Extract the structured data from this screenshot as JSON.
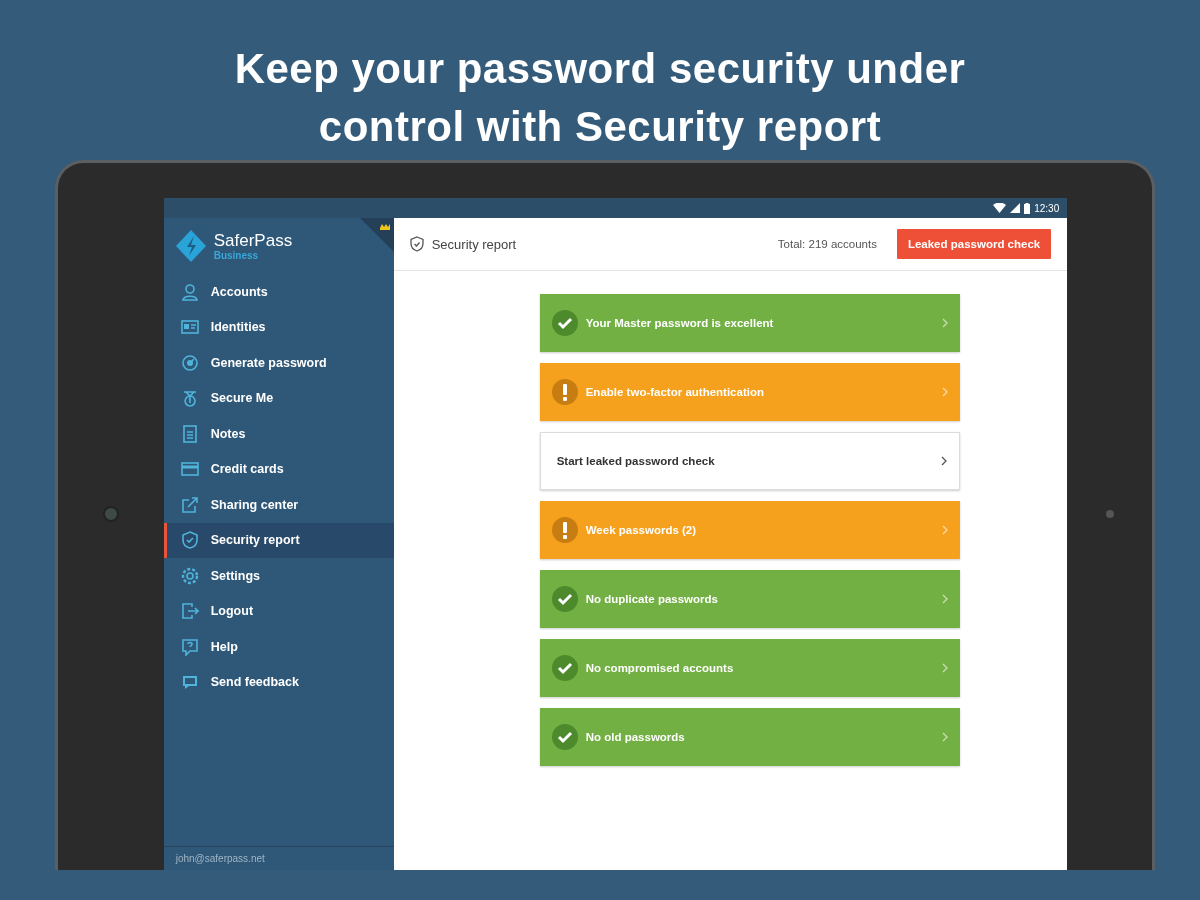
{
  "headline": "Keep your password security under control with Security report",
  "status_bar": {
    "time": "12:30"
  },
  "sidebar": {
    "brand": "SaferPass",
    "edition": "Business",
    "items": [
      {
        "label": "Accounts",
        "selected": false
      },
      {
        "label": "Identities",
        "selected": false
      },
      {
        "label": "Generate password",
        "selected": false
      },
      {
        "label": "Secure Me",
        "selected": false
      },
      {
        "label": "Notes",
        "selected": false
      },
      {
        "label": "Credit cards",
        "selected": false
      },
      {
        "label": "Sharing center",
        "selected": false
      },
      {
        "label": "Security report",
        "selected": true
      },
      {
        "label": "Settings",
        "selected": false
      },
      {
        "label": "Logout",
        "selected": false
      },
      {
        "label": "Help",
        "selected": false
      },
      {
        "label": "Send feedback",
        "selected": false
      }
    ],
    "account": "john@saferpass.net"
  },
  "header": {
    "title": "Security report",
    "total": "Total: 219 accounts",
    "button": "Leaked password check"
  },
  "checks": [
    {
      "kind": "pass",
      "label": "Your Master password is excellent"
    },
    {
      "kind": "warn",
      "label": "Enable two-factor authentication"
    },
    {
      "kind": "action",
      "label": "Start leaked password check"
    },
    {
      "kind": "warn",
      "label": "Week passwords (2)"
    },
    {
      "kind": "pass",
      "label": "No duplicate passwords"
    },
    {
      "kind": "pass",
      "label": "No compromised accounts"
    },
    {
      "kind": "pass",
      "label": "No old passwords"
    }
  ]
}
